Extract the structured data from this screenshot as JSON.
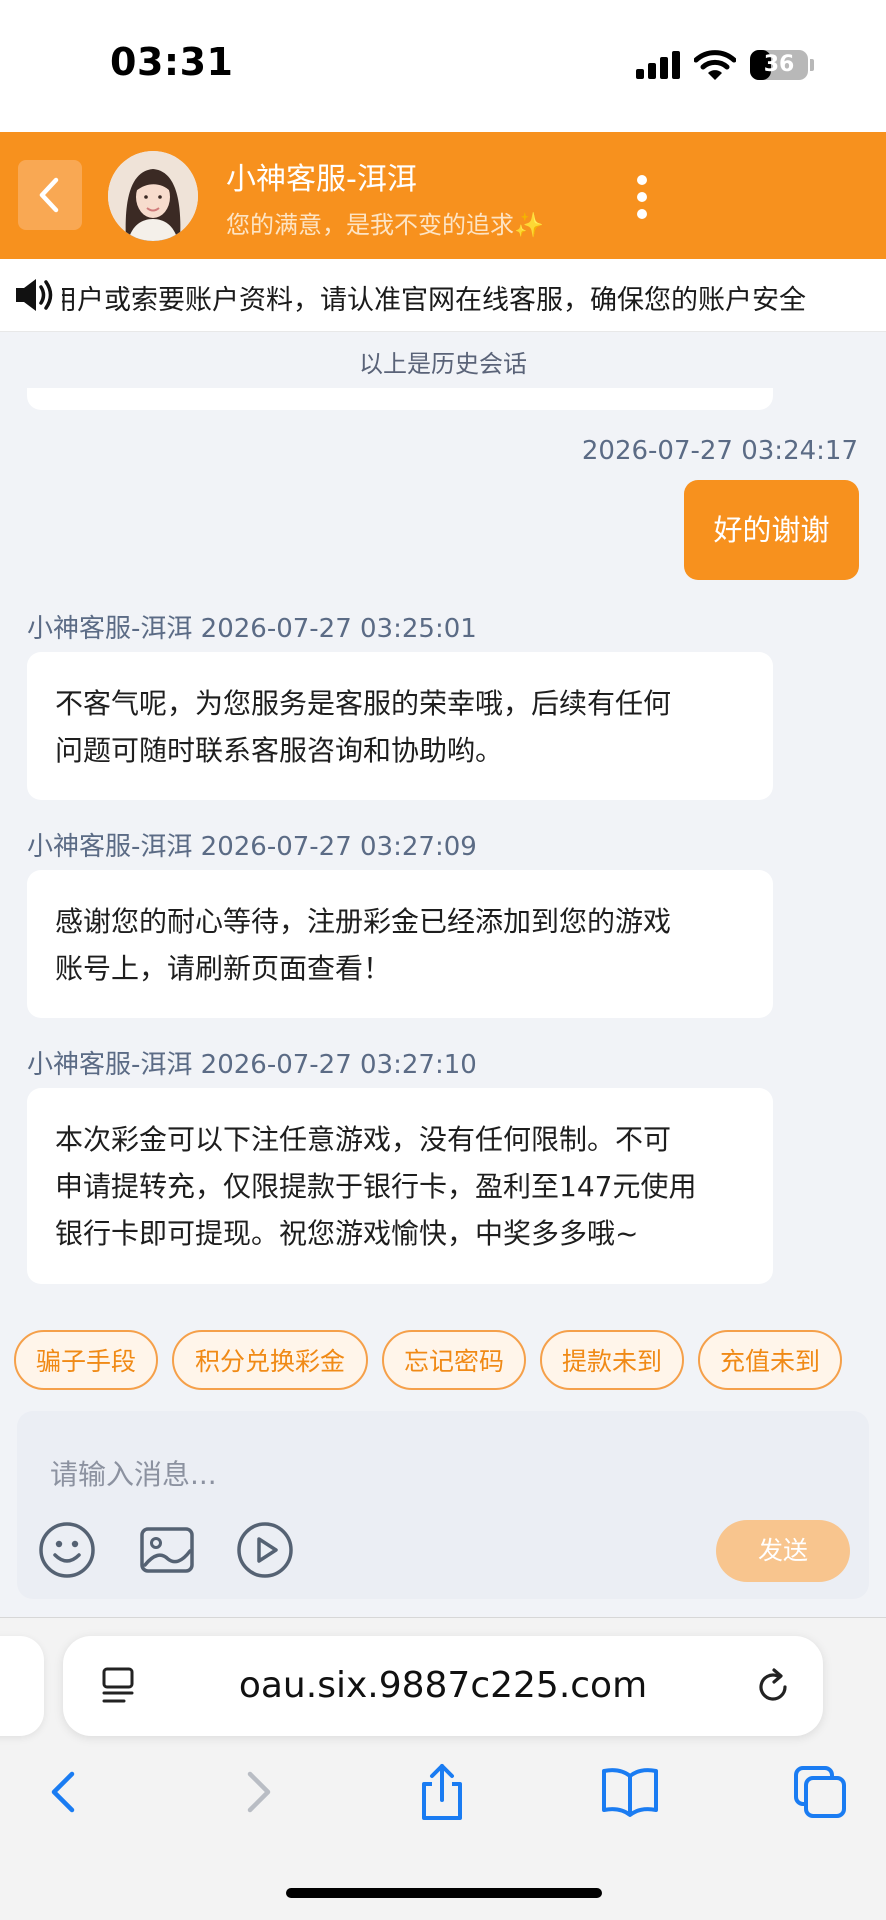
{
  "status_bar": {
    "time": "03:31",
    "battery": "36",
    "battery_level": 0.36
  },
  "header": {
    "agent_name": "小神客服-洱洱",
    "agent_subtitle": "您的满意，是我不变的追求✨"
  },
  "notice": {
    "text": "用户或索要账户资料，请认准官网在线客服，确保您的账户安全"
  },
  "chat": {
    "history_divider": "以上是历史会话",
    "messages": [
      {
        "meta": "2026-07-27 03:24:17",
        "text": "好的谢谢"
      },
      {
        "meta": "小神客服-洱洱 2026-07-27 03:25:01",
        "lines": [
          "不客气呢，为您服务是客服的荣幸哦，后续有任何",
          "问题可随时联系客服咨询和协助哟。"
        ]
      },
      {
        "meta": "小神客服-洱洱 2026-07-27 03:27:09",
        "lines": [
          "感谢您的耐心等待，注册彩金已经添加到您的游戏",
          "账号上，请刷新页面查看！"
        ]
      },
      {
        "meta": "小神客服-洱洱 2026-07-27 03:27:10",
        "lines": [
          "本次彩金可以下注任意游戏，没有任何限制。不可",
          "申请提转充，仅限提款于银行卡，盈利至147元使用",
          "银行卡即可提现。祝您游戏愉快，中奖多多哦~"
        ]
      }
    ]
  },
  "quick_replies": [
    "骗子手段",
    "积分兑换彩金",
    "忘记密码",
    "提款未到",
    "充值未到"
  ],
  "composer": {
    "placeholder": "请输入消息...",
    "send_label": "发送"
  },
  "browser": {
    "url": "oau.six.9887c225.com"
  },
  "colors": {
    "brand": "#f7911e",
    "chip_border": "#f5a04a",
    "send_disabled": "#f8c58e"
  },
  "icons": [
    "back-arrow-icon",
    "more-vertical-icon",
    "speaker-icon",
    "emoji-icon",
    "image-icon",
    "video-play-icon",
    "reader-icon",
    "reload-icon",
    "back-icon",
    "forward-icon",
    "share-icon",
    "bookmarks-icon",
    "tabs-icon"
  ]
}
